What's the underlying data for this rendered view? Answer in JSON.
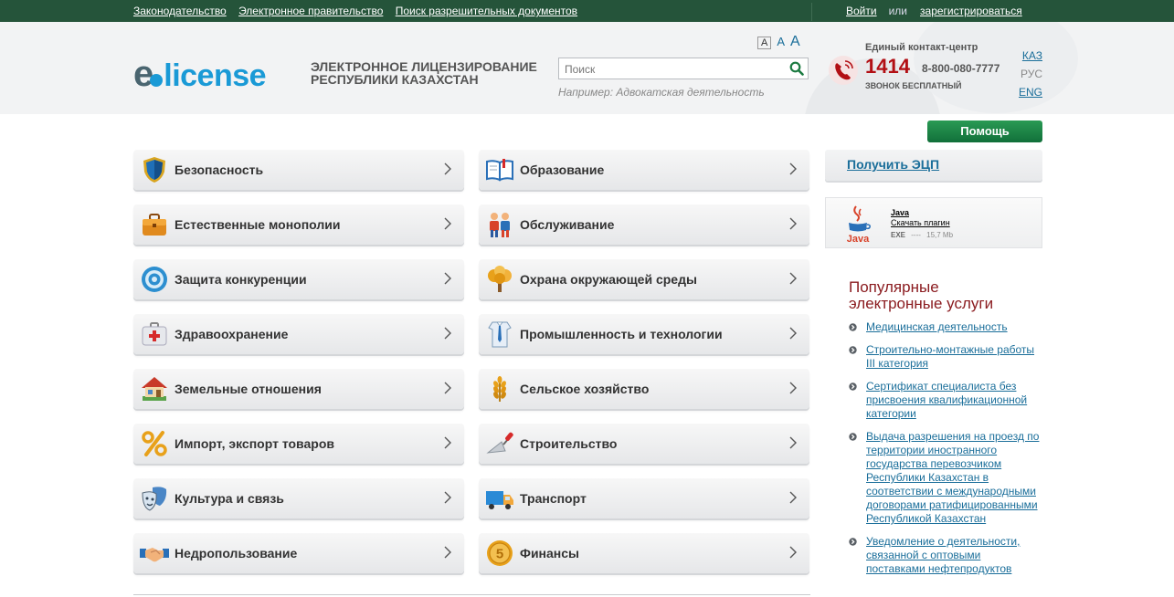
{
  "topbar": {
    "links": [
      "Законодательство",
      "Электронное правительство",
      "Поиск разрешительных документов"
    ],
    "login": "Войти",
    "or": "или",
    "register": "зарегистрироваться"
  },
  "header": {
    "logo_e": "e",
    "logo_license": "license",
    "tagline_line1": "Электронное лицензирование",
    "tagline_line2": "Республики Казахстан",
    "font_sizes": [
      "A",
      "A",
      "A"
    ],
    "search_placeholder": "Поиск",
    "search_example": "Например: Адвокатская деятельность",
    "contact_title": "Единый контакт-центр",
    "contact_short": "1414",
    "contact_long": "8-800-080-7777",
    "contact_free": "ЗВОНОК БЕСПЛАТНЫЙ",
    "languages": [
      {
        "label": "КАЗ",
        "active": false
      },
      {
        "label": "РУС",
        "active": true
      },
      {
        "label": "ENG",
        "active": false
      }
    ]
  },
  "help_label": "Помощь",
  "categories": {
    "left": [
      {
        "label": "Безопасность",
        "icon": "shield-icon"
      },
      {
        "label": "Естественные монополии",
        "icon": "briefcase-icon"
      },
      {
        "label": "Защита конкуренции",
        "icon": "target-icon"
      },
      {
        "label": "Здравоохранение",
        "icon": "first-aid-icon"
      },
      {
        "label": "Земельные отношения",
        "icon": "house-icon"
      },
      {
        "label": "Импорт, экспорт товаров",
        "icon": "percent-icon"
      },
      {
        "label": "Культура и связь",
        "icon": "theater-masks-icon"
      },
      {
        "label": "Недропользование",
        "icon": "handshake-icon"
      }
    ],
    "right": [
      {
        "label": "Образование",
        "icon": "open-book-icon"
      },
      {
        "label": "Обслуживание",
        "icon": "people-icon"
      },
      {
        "label": "Охрана окружающей среды",
        "icon": "tree-icon"
      },
      {
        "label": "Промышленность и технологии",
        "icon": "shirt-tie-icon"
      },
      {
        "label": "Сельское хозяйство",
        "icon": "wheat-icon"
      },
      {
        "label": "Строительство",
        "icon": "trowel-icon"
      },
      {
        "label": "Транспорт",
        "icon": "truck-icon"
      },
      {
        "label": "Финансы",
        "icon": "coin-icon"
      }
    ]
  },
  "sidebar": {
    "ecp_link": "Получить ЭЦП",
    "java": {
      "icon_label": "Java",
      "name": "Java",
      "download": "Скачать плагин",
      "type": "EXE",
      "dash": "----",
      "size": "15,7 Mb"
    },
    "popular_title_line1": "Популярные",
    "popular_title_line2": "электронные услуги",
    "popular": [
      "Медицинская деятельность",
      "Строительно-монтажные работы III категория",
      "Сертификат специалиста без присвоения квалификационной категории",
      "Выдача разрешения на проезд по территории иностранного государства перевозчиком Республики Казахстан в соответствии с международными договорами ратифицированными Республикой Казахстан",
      "Уведомление о деятельности, связанной с оптовыми поставками нефтепродуктов"
    ]
  },
  "colors": {
    "topbar": "#25543a",
    "brand_blue": "#1a9ad6",
    "link": "#1a6e9a",
    "accent_red": "#b20f14",
    "help_green": "#1e8a48"
  }
}
